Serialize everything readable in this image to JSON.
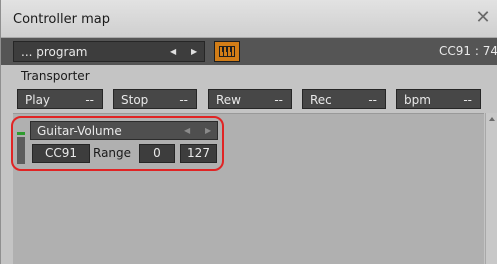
{
  "window": {
    "title": "Controller map",
    "close_icon": "close-icon"
  },
  "toolbar": {
    "program_label": "... program",
    "prev_icon": "triangle-left-icon",
    "next_icon": "triangle-right-icon",
    "keyboard_icon": "piano-keyboard-icon",
    "accent_color": "#d27d17",
    "cc_readout": "CC91 : 74"
  },
  "transporter": {
    "label": "Transporter",
    "buttons": [
      {
        "label": "Play",
        "value": "--"
      },
      {
        "label": "Stop",
        "value": "--"
      },
      {
        "label": "Rew",
        "value": "--"
      },
      {
        "label": "Rec",
        "value": "--"
      },
      {
        "label": "bpm",
        "value": "--"
      }
    ]
  },
  "controller": {
    "name": "Guitar-Volume",
    "cc": "CC91",
    "range_label": "Range",
    "range_min": "0",
    "range_max": "127",
    "highlight_color": "#e02424",
    "indicator_color": "#2f9c2f"
  }
}
